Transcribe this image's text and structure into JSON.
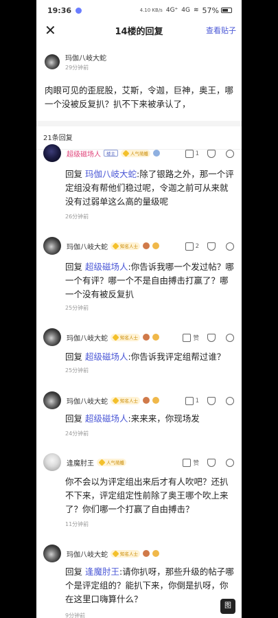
{
  "status_bar": {
    "time": "19:36",
    "net_speed": "4.10 KB/s",
    "signal1": "4G⁺",
    "signal2": "4G",
    "battery": "57%",
    "battery_level": 0.57
  },
  "nav": {
    "close_icon": "close-icon",
    "title": "14楼的回复",
    "view_post": "查看贴子"
  },
  "op": {
    "username": "玛伽八岐大蛇",
    "time": "29分钟前",
    "body": "肉眼可见的歪屁股，艾斯，令迦，巨神，奥王，哪一个没被反复扒？扒不下来被承认了，"
  },
  "reply_count": "21条回复",
  "replies": [
    {
      "username": "超级磁场人",
      "vip": true,
      "badge1": "楼主",
      "badge2": "人气萌蠖",
      "like_count": "1",
      "prefix": "回复",
      "mention": "玛伽八岐大蛇",
      "text": ":除了银路之外，那一个评定组没有帮他们稳过呢，令迦之前可从来就没有过弱单这么高的量级呢",
      "time": "26分钟前"
    },
    {
      "username": "玛伽八岐大蛇",
      "badge2": "知名人士",
      "like_count": "2",
      "prefix": "回复",
      "mention": "超级磁场人",
      "text": ":你告诉我哪一个发过帖？哪一个有评？哪一个不是自由搏击打赢了？哪一个没有被反复扒",
      "time": "25分钟前"
    },
    {
      "username": "玛伽八岐大蛇",
      "badge2": "知名人士",
      "like_count": "赞",
      "prefix": "回复",
      "mention": "超级磁场人",
      "text": ":你告诉我评定组帮过谁？",
      "time": "25分钟前"
    },
    {
      "username": "玛伽八岐大蛇",
      "badge2": "知名人士",
      "like_count": "1",
      "prefix": "回复",
      "mention": "超级磁场人",
      "text": ":来来来，你现场发",
      "time": "24分钟前"
    },
    {
      "username": "逢魔肘王",
      "badge2": "人气萌蠖",
      "like_count": "赞",
      "prefix": "",
      "mention": "",
      "text": "你不会以为评定组出来后才有人吹吧？还扒不下来，评定组定性前除了奥王哪个吹上来了？你们哪一个打赢了自由搏击？",
      "time": "11分钟前"
    },
    {
      "username": "玛伽八岐大蛇",
      "badge2": "知名人士",
      "like_count": "1",
      "prefix": "回复",
      "mention": "逢魔肘王",
      "text": ":请你扒呀，那些升级的帖子哪个是评定组的？能扒下来，你倒是扒呀，你在这里口嗨算什么？",
      "time": "9分钟前"
    }
  ],
  "fab_label": "图"
}
